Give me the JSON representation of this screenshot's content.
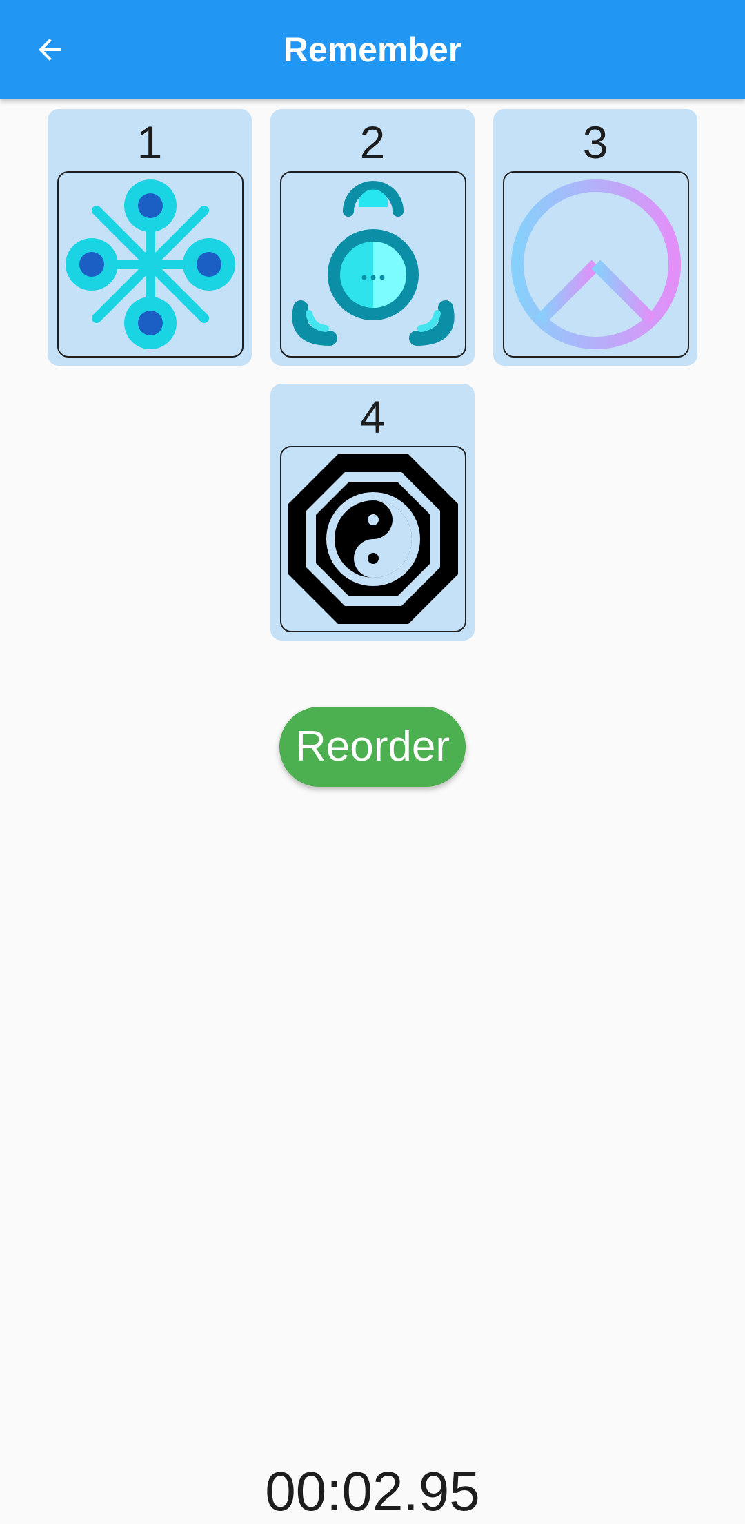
{
  "app_bar": {
    "title": "Remember",
    "back_icon": "arrow-back-icon",
    "background_color": "#2196f3"
  },
  "cards": [
    {
      "number": "1",
      "icon": "snowflake-molecule-icon"
    },
    {
      "number": "2",
      "icon": "bomb-timer-icon"
    },
    {
      "number": "3",
      "icon": "peace-sign-icon"
    },
    {
      "number": "4",
      "icon": "yin-yang-octagon-icon"
    }
  ],
  "reorder_button": {
    "label": "Reorder",
    "color": "#4caf50"
  },
  "timer": {
    "value": "00:02.95"
  }
}
